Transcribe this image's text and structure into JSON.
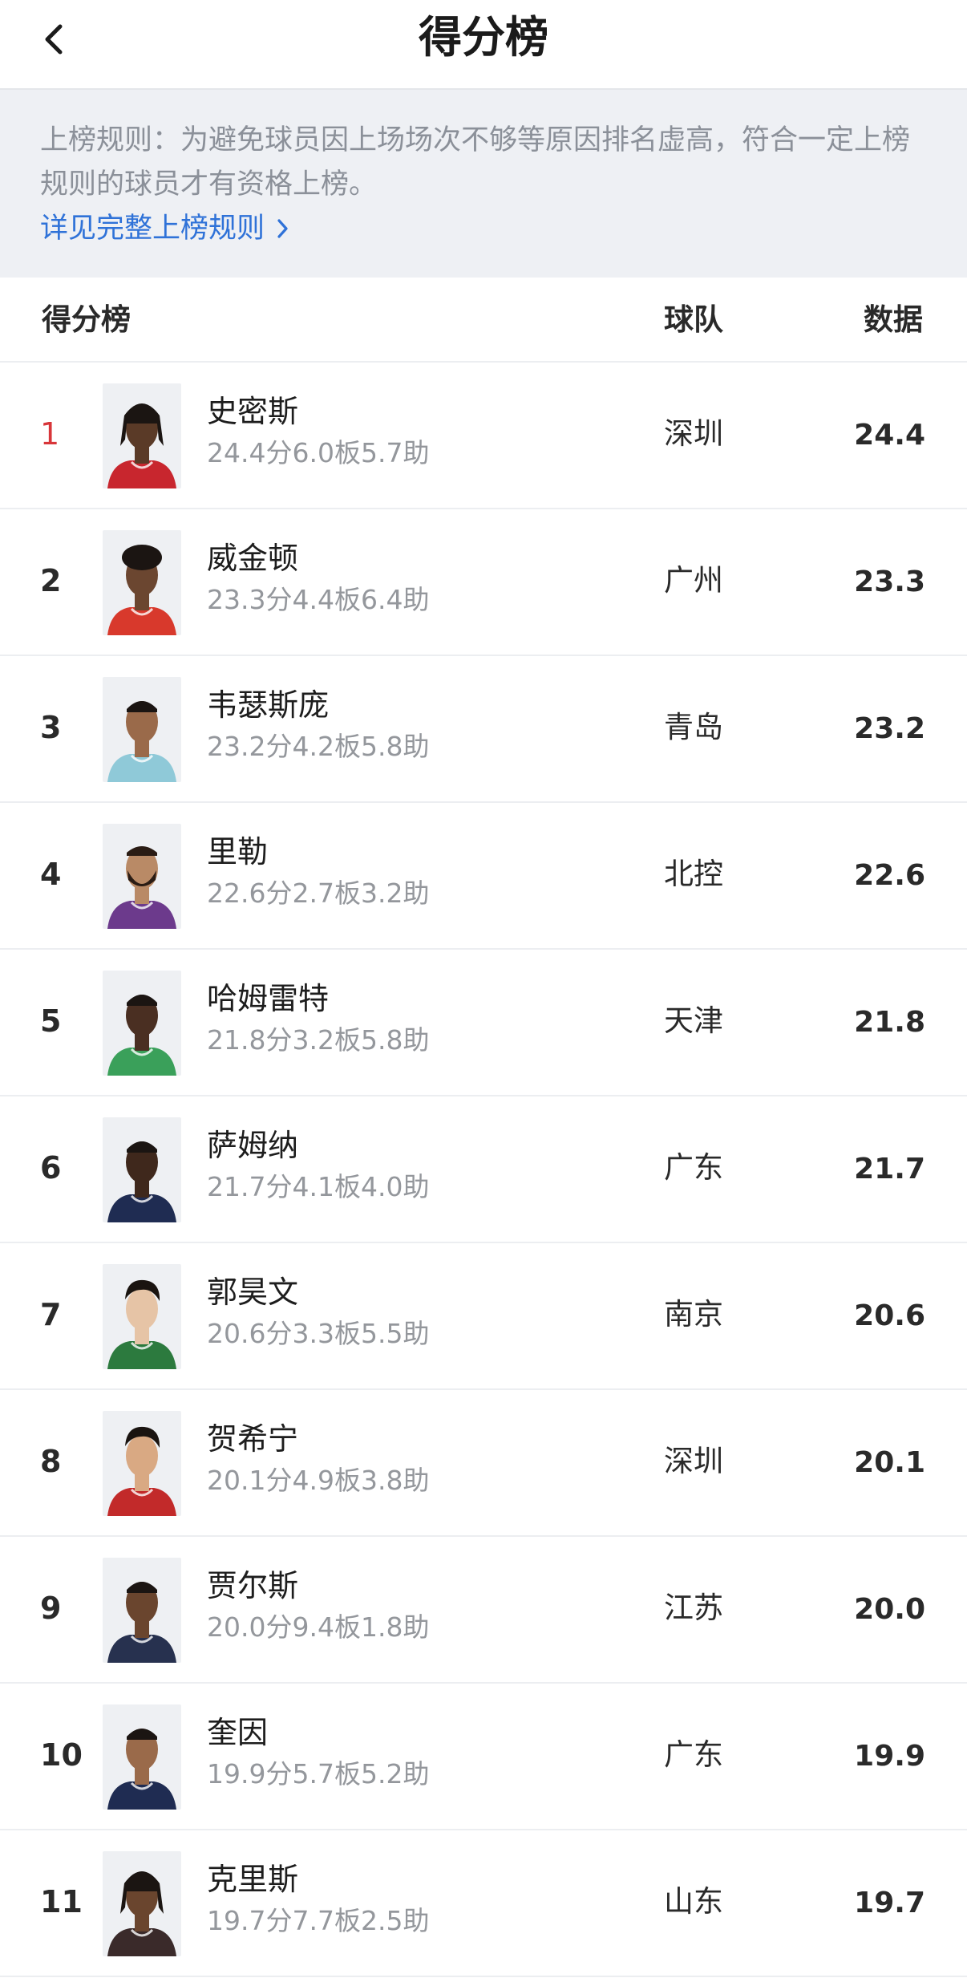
{
  "header": {
    "title": "得分榜"
  },
  "notice": {
    "text": "上榜规则：为避免球员因上场场次不够等原因排名虚高，符合一定上榜规则的球员才有资格上榜。",
    "link": "详见完整上榜规则"
  },
  "columns": {
    "board": "得分榜",
    "team": "球队",
    "data": "数据"
  },
  "colors": {
    "accent_link": "#2f72d8",
    "rank_top": "#d8363a",
    "notice_bg": "#eef0f4"
  },
  "players": [
    {
      "rank": "1",
      "name": "史密斯",
      "stats": "24.4分6.0板5.7助",
      "team": "深圳",
      "value": "24.4",
      "jersey": "#c8262e",
      "skin": "#5a3a27",
      "hair": "dreads"
    },
    {
      "rank": "2",
      "name": "威金顿",
      "stats": "23.3分4.4板6.4助",
      "team": "广州",
      "value": "23.3",
      "jersey": "#d8392c",
      "skin": "#6b4630",
      "hair": "curly"
    },
    {
      "rank": "3",
      "name": "韦瑟斯庞",
      "stats": "23.2分4.2板5.8助",
      "team": "青岛",
      "value": "23.2",
      "jersey": "#8fc9d8",
      "skin": "#9a6a4a",
      "hair": "short"
    },
    {
      "rank": "4",
      "name": "里勒",
      "stats": "22.6分2.7板3.2助",
      "team": "北控",
      "value": "22.6",
      "jersey": "#6c3a8c",
      "skin": "#b98a66",
      "hair": "beard"
    },
    {
      "rank": "5",
      "name": "哈姆雷特",
      "stats": "21.8分3.2板5.8助",
      "team": "天津",
      "value": "21.8",
      "jersey": "#3aa05a",
      "skin": "#4a2f22",
      "hair": "short"
    },
    {
      "rank": "6",
      "name": "萨姆纳",
      "stats": "21.7分4.1板4.0助",
      "team": "广东",
      "value": "21.7",
      "jersey": "#1f2c52",
      "skin": "#3f281c",
      "hair": "short"
    },
    {
      "rank": "7",
      "name": "郭昊文",
      "stats": "20.6分3.3板5.5助",
      "team": "南京",
      "value": "20.6",
      "jersey": "#2c7a3e",
      "skin": "#e6c4a6",
      "hair": "asian"
    },
    {
      "rank": "8",
      "name": "贺希宁",
      "stats": "20.1分4.9板3.8助",
      "team": "深圳",
      "value": "20.1",
      "jersey": "#c22a2a",
      "skin": "#d9a983",
      "hair": "asian"
    },
    {
      "rank": "9",
      "name": "贾尔斯",
      "stats": "20.0分9.4板1.8助",
      "team": "江苏",
      "value": "20.0",
      "jersey": "#27314f",
      "skin": "#6a452e",
      "hair": "short"
    },
    {
      "rank": "10",
      "name": "奎因",
      "stats": "19.9分5.7板5.2助",
      "team": "广东",
      "value": "19.9",
      "jersey": "#1f2c52",
      "skin": "#9a6a4a",
      "hair": "short"
    },
    {
      "rank": "11",
      "name": "克里斯",
      "stats": "19.7分7.7板2.5助",
      "team": "山东",
      "value": "19.7",
      "jersey": "#3a2a2a",
      "skin": "#6a452e",
      "hair": "dreads"
    }
  ]
}
